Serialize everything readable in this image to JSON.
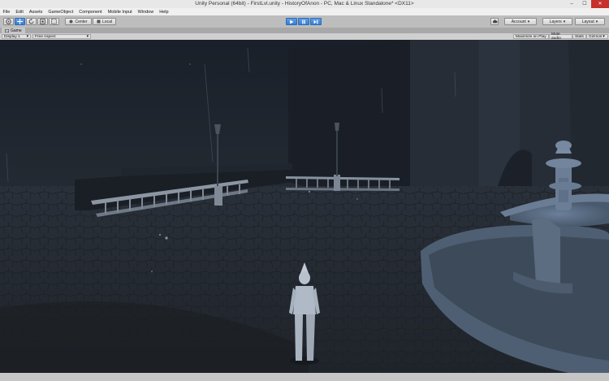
{
  "window": {
    "title": "Unity Personal (64bit) - FirstLvl.unity - HistoryOfAnon - PC, Mac & Linux Standalone* <DX11>",
    "minimize": "–",
    "maximize": "☐",
    "close": "✕"
  },
  "menu": {
    "items": [
      "File",
      "Edit",
      "Assets",
      "GameObject",
      "Component",
      "Mobile Input",
      "Window",
      "Help"
    ]
  },
  "toolbar": {
    "pivot_label": "Center",
    "space_label": "Local",
    "account_label": "Account",
    "layers_label": "Layers",
    "layout_label": "Layout",
    "dropdown_glyph": "▾"
  },
  "tabs": {
    "game_label": "Game"
  },
  "game_view": {
    "display_label": "Display 1",
    "aspect_label": "Free Aspect",
    "maximize_on_play": "Maximize on Play",
    "mute_audio": "Mute audio",
    "stats": "Stats",
    "gizmos": "Gizmos"
  },
  "colors": {
    "play_active": "#3b7fd1",
    "sky": "#1c222b",
    "ground": "#222831",
    "fountain": "#5d6f85",
    "character": "#b7c1ce"
  },
  "icons": {
    "hand": "hand-tool-icon",
    "move": "move-tool-icon",
    "rotate": "rotate-tool-icon",
    "scale": "scale-tool-icon",
    "rect": "rect-tool-icon",
    "play": "play-icon",
    "pause": "pause-icon",
    "step": "step-icon",
    "cloud": "cloud-icon"
  }
}
